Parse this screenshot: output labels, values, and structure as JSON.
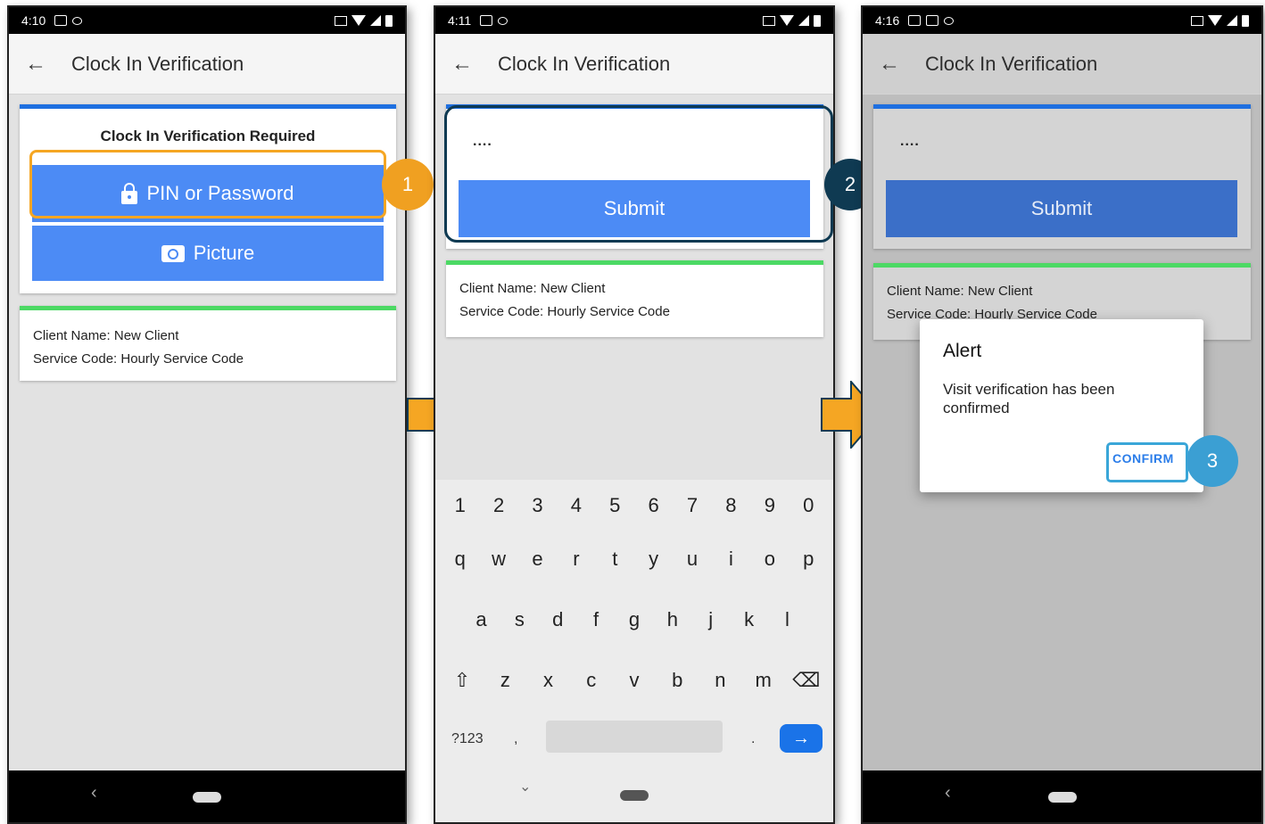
{
  "screens": [
    {
      "status_time": "4:10",
      "title": "Clock In Verification",
      "card_title": "Clock In Verification Required",
      "pin_button": "PIN or Password",
      "picture_button": "Picture",
      "client_name": "Client Name: New Client",
      "service_code": "Service Code: Hourly Service Code",
      "step": "1"
    },
    {
      "status_time": "4:11",
      "title": "Clock In Verification",
      "pin_value": "....",
      "submit_button": "Submit",
      "client_name": "Client Name: New Client",
      "service_code": "Service Code: Hourly Service Code",
      "step": "2",
      "keyboard": {
        "numbers": [
          "1",
          "2",
          "3",
          "4",
          "5",
          "6",
          "7",
          "8",
          "9",
          "0"
        ],
        "row1": [
          "q",
          "w",
          "e",
          "r",
          "t",
          "y",
          "u",
          "i",
          "o",
          "p"
        ],
        "row2": [
          "a",
          "s",
          "d",
          "f",
          "g",
          "h",
          "j",
          "k",
          "l"
        ],
        "row3": [
          "⇧",
          "z",
          "x",
          "c",
          "v",
          "b",
          "n",
          "m",
          "⌫"
        ],
        "symbols_key": "?123",
        "comma": ",",
        "period": ".",
        "enter": "→"
      }
    },
    {
      "status_time": "4:16",
      "title": "Clock In Verification",
      "pin_value": "....",
      "submit_button": "Submit",
      "client_name": "Client Name: New Client",
      "service_code": "Service Code: Hourly Service Code",
      "alert_title": "Alert",
      "alert_message": "Visit verification has been confirmed",
      "confirm_button": "CONFIRM",
      "step": "3"
    }
  ],
  "colors": {
    "primary_button": "#4c8bf5",
    "card_accent_blue": "#1e6fe0",
    "card_accent_green": "#4cd964",
    "step1": "#f0a021",
    "step2": "#0f3a52",
    "step3": "#3b9fd3",
    "arrow": "#f5a623"
  },
  "icons": {
    "back": "arrow-left-icon",
    "pin": "lock-icon",
    "picture": "camera-icon",
    "flow": "arrow-right-icon"
  }
}
